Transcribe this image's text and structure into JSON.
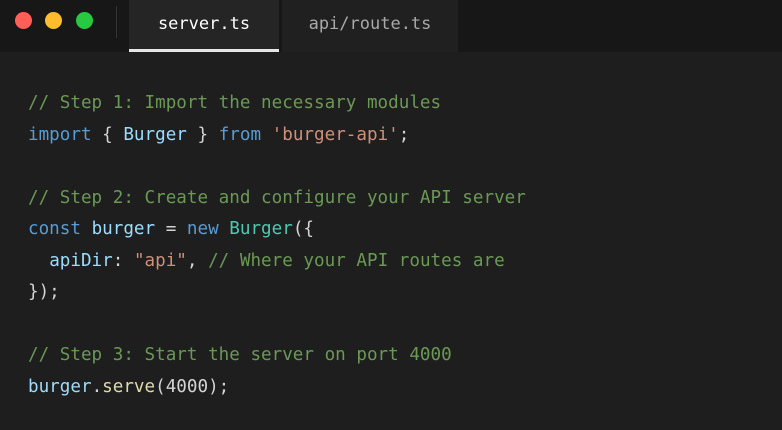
{
  "tabs": [
    {
      "label": "server.ts",
      "active": true
    },
    {
      "label": "api/route.ts",
      "active": false
    }
  ],
  "window_controls": [
    "close",
    "minimize",
    "maximize"
  ],
  "code": {
    "line1": {
      "comment": "// Step 1: Import the necessary modules"
    },
    "line2": {
      "kw_import": "import",
      "brace_open": " { ",
      "ident": "Burger",
      "brace_close": " } ",
      "kw_from": "from",
      "sp": " ",
      "string": "'burger-api'",
      "semi": ";"
    },
    "line4": {
      "comment": "// Step 2: Create and configure your API server"
    },
    "line5": {
      "kw_const": "const",
      "sp1": " ",
      "var": "burger",
      "eq": " = ",
      "kw_new": "new",
      "sp2": " ",
      "cls": "Burger",
      "paren": "({"
    },
    "line6": {
      "indent": "  ",
      "prop": "apiDir",
      "colon": ": ",
      "string": "\"api\"",
      "comma": ", ",
      "comment": "// Where your API routes are"
    },
    "line7": {
      "close": "});"
    },
    "line9": {
      "comment": "// Step 3: Start the server on port 4000"
    },
    "line10": {
      "obj": "burger",
      "dot": ".",
      "method": "serve",
      "paren_open": "(",
      "number": "4000",
      "paren_close": ");"
    }
  },
  "colors": {
    "background": "#1e1e1e",
    "titlebar": "#171717",
    "comment": "#6a9955",
    "keyword": "#569cd6",
    "class": "#4ec9b0",
    "identifier": "#9cdcfe",
    "string": "#ce9178",
    "close_dot": "#ff5f57",
    "minimize_dot": "#febc2e",
    "maximize_dot": "#28c840"
  }
}
